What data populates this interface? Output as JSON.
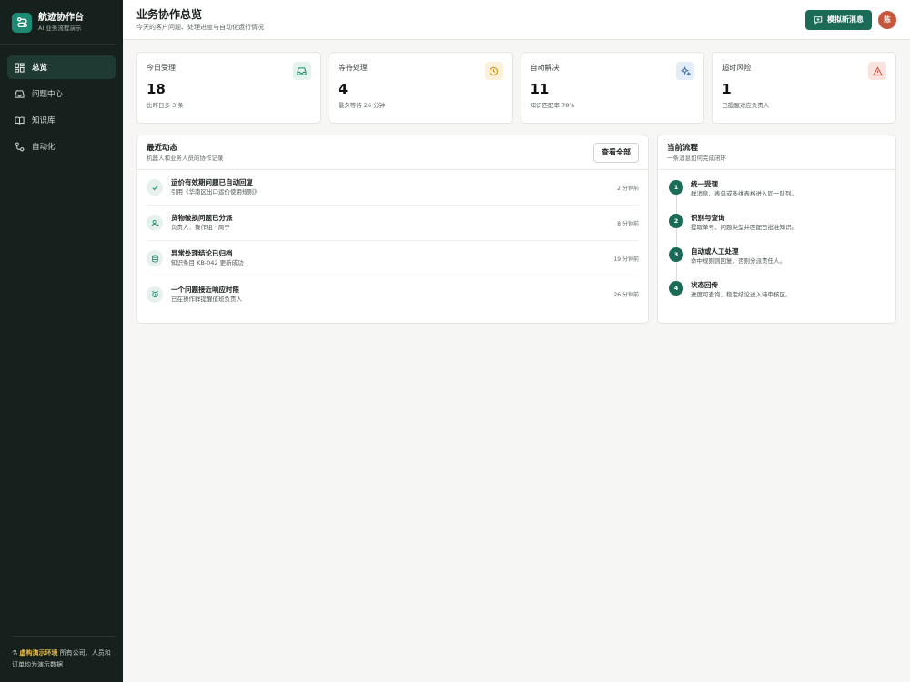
{
  "brand": {
    "name": "航迹协作台",
    "subtitle": "AI 业务流程演示"
  },
  "nav": [
    {
      "label": "总览",
      "icon": "dashboard-icon",
      "active": true
    },
    {
      "label": "问题中心",
      "icon": "inbox-icon",
      "active": false
    },
    {
      "label": "知识库",
      "icon": "book-icon",
      "active": false
    },
    {
      "label": "自动化",
      "icon": "workflow-icon",
      "active": false
    }
  ],
  "demo_note": {
    "tag": "虚构演示环境",
    "text": "所有公司、人员和订单均为演示数据"
  },
  "header": {
    "title": "业务协作总览",
    "subtitle": "今天的客户问题、处理进度与自动化运行情况",
    "simulate_button": "模拟新消息",
    "avatar": "陈"
  },
  "stats": [
    {
      "label": "今日受理",
      "value": "18",
      "note": "比昨日多 3 条",
      "icon": "inbox-icon",
      "icon_color": "#1f8a6e",
      "icon_bg": "#e3f2ec"
    },
    {
      "label": "等待处理",
      "value": "4",
      "note": "最久等待 26 分钟",
      "icon": "clock-icon",
      "icon_color": "#c98a12",
      "icon_bg": "#fbf0d8"
    },
    {
      "label": "自动解决",
      "value": "11",
      "note": "知识匹配率 78%",
      "icon": "sparkle-icon",
      "icon_color": "#3e6fb3",
      "icon_bg": "#e4ecf7"
    },
    {
      "label": "超时风险",
      "value": "1",
      "note": "已提醒对应负责人",
      "icon": "warning-icon",
      "icon_color": "#c45343",
      "icon_bg": "#f9e3df"
    }
  ],
  "activity": {
    "title": "最近动态",
    "subtitle": "机器人和业务人员的协作记录",
    "view_all": "查看全部",
    "items": [
      {
        "title": "运价有效期问题已自动回复",
        "desc": "引用《华南区出口运价使用规则》",
        "time": "2 分钟前",
        "icon": "check-icon"
      },
      {
        "title": "货物破损问题已分派",
        "desc": "负责人：操作组 · 周宁",
        "time": "8 分钟前",
        "icon": "user-assign-icon"
      },
      {
        "title": "异常处理结论已归档",
        "desc": "知识条目 KB-042 更新成功",
        "time": "19 分钟前",
        "icon": "database-icon"
      },
      {
        "title": "一个问题接近响应时限",
        "desc": "已在操作群提醒值班负责人",
        "time": "26 分钟前",
        "icon": "alarm-icon"
      }
    ]
  },
  "flow": {
    "title": "当前流程",
    "subtitle": "一条消息如何完成闭环",
    "steps": [
      {
        "num": "1",
        "title": "统一受理",
        "desc": "群消息、表单或多维表格进入同一队列。"
      },
      {
        "num": "2",
        "title": "识别与查询",
        "desc": "提取单号、问题类型并匹配已批准知识。"
      },
      {
        "num": "3",
        "title": "自动或人工处理",
        "desc": "命中规则则回复，否则分派责任人。"
      },
      {
        "num": "4",
        "title": "状态回传",
        "desc": "进度可查询，稳定结论进入待审核区。"
      }
    ]
  }
}
